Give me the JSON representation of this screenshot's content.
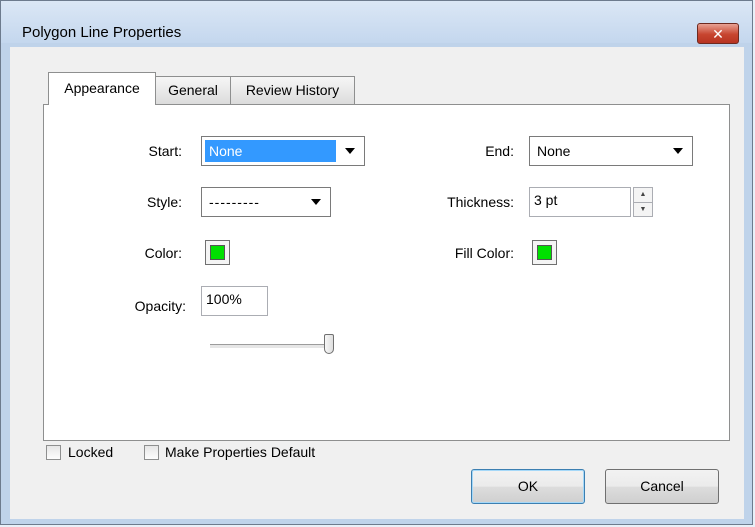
{
  "window": {
    "title": "Polygon Line Properties",
    "close_symbol": "✕"
  },
  "tabs": [
    {
      "label": "Appearance",
      "active": true
    },
    {
      "label": "General",
      "active": false
    },
    {
      "label": "Review History",
      "active": false
    }
  ],
  "appearance": {
    "start_label": "Start:",
    "start_value": "None",
    "end_label": "End:",
    "end_value": "None",
    "style_label": "Style:",
    "style_value": "---------",
    "thickness_label": "Thickness:",
    "thickness_value": "3 pt",
    "color_label": "Color:",
    "color_value": "#00e000",
    "fill_color_label": "Fill Color:",
    "fill_color_value": "#00e000",
    "opacity_label": "Opacity:",
    "opacity_value": "100%",
    "opacity_slider_level": 1.0
  },
  "footer": {
    "locked_label": "Locked",
    "locked_checked": false,
    "make_default_label": "Make Properties Default",
    "make_default_checked": false,
    "ok_label": "OK",
    "cancel_label": "Cancel"
  },
  "icons": {
    "close": "close-icon",
    "dropdown": "chevron-down-icon",
    "spin_up": "spin-up-icon",
    "spin_down": "spin-down-icon"
  }
}
